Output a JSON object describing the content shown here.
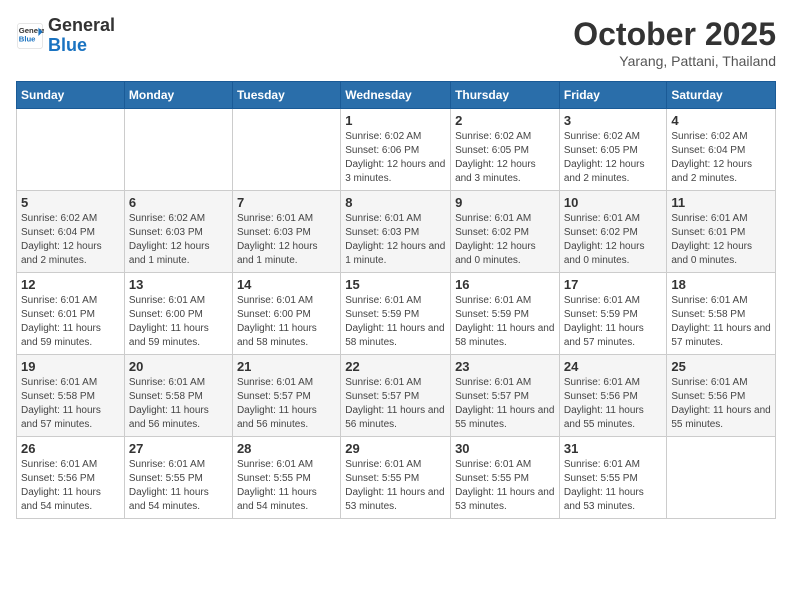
{
  "header": {
    "logo_line1": "General",
    "logo_line2": "Blue",
    "month": "October 2025",
    "location": "Yarang, Pattani, Thailand"
  },
  "weekdays": [
    "Sunday",
    "Monday",
    "Tuesday",
    "Wednesday",
    "Thursday",
    "Friday",
    "Saturday"
  ],
  "weeks": [
    [
      {
        "day": "",
        "info": ""
      },
      {
        "day": "",
        "info": ""
      },
      {
        "day": "",
        "info": ""
      },
      {
        "day": "1",
        "info": "Sunrise: 6:02 AM\nSunset: 6:06 PM\nDaylight: 12 hours and 3 minutes."
      },
      {
        "day": "2",
        "info": "Sunrise: 6:02 AM\nSunset: 6:05 PM\nDaylight: 12 hours and 3 minutes."
      },
      {
        "day": "3",
        "info": "Sunrise: 6:02 AM\nSunset: 6:05 PM\nDaylight: 12 hours and 2 minutes."
      },
      {
        "day": "4",
        "info": "Sunrise: 6:02 AM\nSunset: 6:04 PM\nDaylight: 12 hours and 2 minutes."
      }
    ],
    [
      {
        "day": "5",
        "info": "Sunrise: 6:02 AM\nSunset: 6:04 PM\nDaylight: 12 hours and 2 minutes."
      },
      {
        "day": "6",
        "info": "Sunrise: 6:02 AM\nSunset: 6:03 PM\nDaylight: 12 hours and 1 minute."
      },
      {
        "day": "7",
        "info": "Sunrise: 6:01 AM\nSunset: 6:03 PM\nDaylight: 12 hours and 1 minute."
      },
      {
        "day": "8",
        "info": "Sunrise: 6:01 AM\nSunset: 6:03 PM\nDaylight: 12 hours and 1 minute."
      },
      {
        "day": "9",
        "info": "Sunrise: 6:01 AM\nSunset: 6:02 PM\nDaylight: 12 hours and 0 minutes."
      },
      {
        "day": "10",
        "info": "Sunrise: 6:01 AM\nSunset: 6:02 PM\nDaylight: 12 hours and 0 minutes."
      },
      {
        "day": "11",
        "info": "Sunrise: 6:01 AM\nSunset: 6:01 PM\nDaylight: 12 hours and 0 minutes."
      }
    ],
    [
      {
        "day": "12",
        "info": "Sunrise: 6:01 AM\nSunset: 6:01 PM\nDaylight: 11 hours and 59 minutes."
      },
      {
        "day": "13",
        "info": "Sunrise: 6:01 AM\nSunset: 6:00 PM\nDaylight: 11 hours and 59 minutes."
      },
      {
        "day": "14",
        "info": "Sunrise: 6:01 AM\nSunset: 6:00 PM\nDaylight: 11 hours and 58 minutes."
      },
      {
        "day": "15",
        "info": "Sunrise: 6:01 AM\nSunset: 5:59 PM\nDaylight: 11 hours and 58 minutes."
      },
      {
        "day": "16",
        "info": "Sunrise: 6:01 AM\nSunset: 5:59 PM\nDaylight: 11 hours and 58 minutes."
      },
      {
        "day": "17",
        "info": "Sunrise: 6:01 AM\nSunset: 5:59 PM\nDaylight: 11 hours and 57 minutes."
      },
      {
        "day": "18",
        "info": "Sunrise: 6:01 AM\nSunset: 5:58 PM\nDaylight: 11 hours and 57 minutes."
      }
    ],
    [
      {
        "day": "19",
        "info": "Sunrise: 6:01 AM\nSunset: 5:58 PM\nDaylight: 11 hours and 57 minutes."
      },
      {
        "day": "20",
        "info": "Sunrise: 6:01 AM\nSunset: 5:58 PM\nDaylight: 11 hours and 56 minutes."
      },
      {
        "day": "21",
        "info": "Sunrise: 6:01 AM\nSunset: 5:57 PM\nDaylight: 11 hours and 56 minutes."
      },
      {
        "day": "22",
        "info": "Sunrise: 6:01 AM\nSunset: 5:57 PM\nDaylight: 11 hours and 56 minutes."
      },
      {
        "day": "23",
        "info": "Sunrise: 6:01 AM\nSunset: 5:57 PM\nDaylight: 11 hours and 55 minutes."
      },
      {
        "day": "24",
        "info": "Sunrise: 6:01 AM\nSunset: 5:56 PM\nDaylight: 11 hours and 55 minutes."
      },
      {
        "day": "25",
        "info": "Sunrise: 6:01 AM\nSunset: 5:56 PM\nDaylight: 11 hours and 55 minutes."
      }
    ],
    [
      {
        "day": "26",
        "info": "Sunrise: 6:01 AM\nSunset: 5:56 PM\nDaylight: 11 hours and 54 minutes."
      },
      {
        "day": "27",
        "info": "Sunrise: 6:01 AM\nSunset: 5:55 PM\nDaylight: 11 hours and 54 minutes."
      },
      {
        "day": "28",
        "info": "Sunrise: 6:01 AM\nSunset: 5:55 PM\nDaylight: 11 hours and 54 minutes."
      },
      {
        "day": "29",
        "info": "Sunrise: 6:01 AM\nSunset: 5:55 PM\nDaylight: 11 hours and 53 minutes."
      },
      {
        "day": "30",
        "info": "Sunrise: 6:01 AM\nSunset: 5:55 PM\nDaylight: 11 hours and 53 minutes."
      },
      {
        "day": "31",
        "info": "Sunrise: 6:01 AM\nSunset: 5:55 PM\nDaylight: 11 hours and 53 minutes."
      },
      {
        "day": "",
        "info": ""
      }
    ]
  ]
}
